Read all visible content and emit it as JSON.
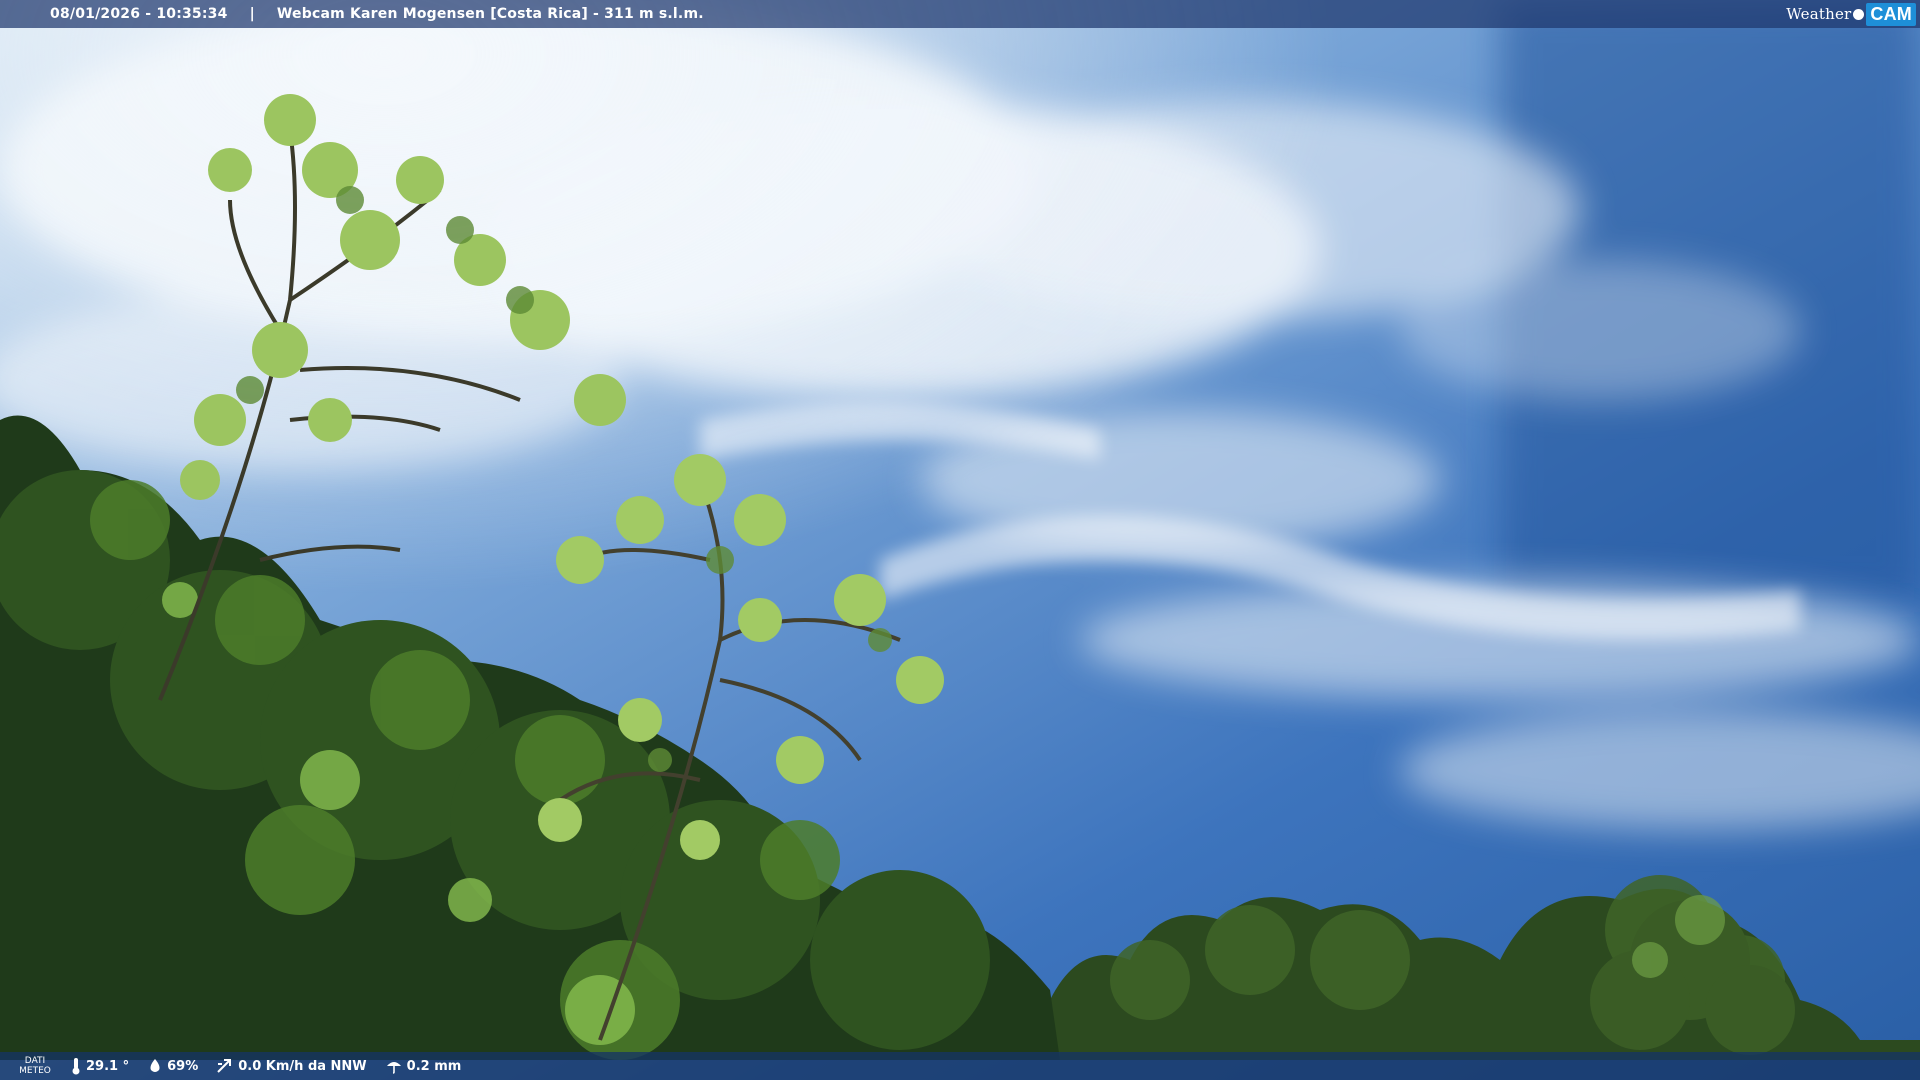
{
  "header": {
    "datetime": "08/01/2026 - 10:35:34",
    "separator": "|",
    "title": "Webcam Karen Mogensen [Costa Rica]  - 311 m s.l.m."
  },
  "brand": {
    "weather": "Weather",
    "cam": "CAM"
  },
  "footer": {
    "dati_line1": "DATI",
    "dati_line2": "METEO",
    "temperature": "29.1 °",
    "humidity": "69%",
    "wind": "0.0 Km/h da NNW",
    "rain": "0.2 mm"
  },
  "icons": {
    "temperature": "thermometer-icon",
    "humidity": "droplet-icon",
    "wind": "wind-icon",
    "rain": "rain-icon"
  },
  "colors": {
    "sky_top": "#2a5fa6",
    "sky_light": "#8fb7e2",
    "cloud": "#eef4fa",
    "foliage_dark": "#1f3a1a",
    "foliage_mid": "#3e6a22",
    "foliage_light": "#8fc35a"
  }
}
